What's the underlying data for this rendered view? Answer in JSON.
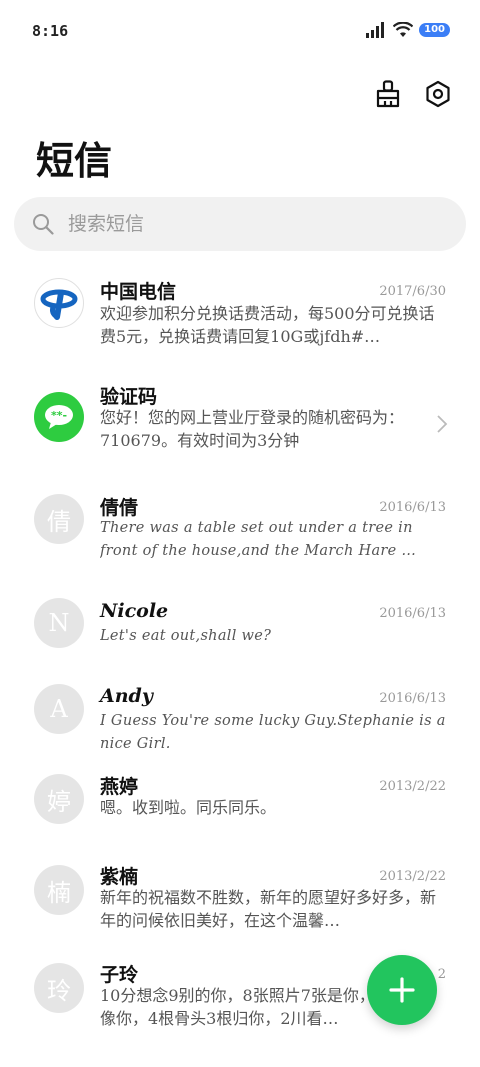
{
  "status_bar": {
    "time": "8:16",
    "battery": "100"
  },
  "page": {
    "title": "短信"
  },
  "search": {
    "placeholder": "搜索短信"
  },
  "messages": [
    {
      "name": "中国电信",
      "date": "2017/6/30",
      "preview": "欢迎参加积分兑换话费活动，每500分可兑换话费5元，兑换话费请回复10G或jfdh#…",
      "avatar": "telecom-logo"
    },
    {
      "name": "验证码",
      "date": "",
      "preview": "您好！您的网上营业厅登录的随机密码为：710679。有效时间为3分钟",
      "avatar": "message-bubble-icon"
    },
    {
      "name": "倩倩",
      "date": "2016/6/13",
      "preview": "There was a table set out under a tree in front of the house,and the March Hare …",
      "avatar_letter": "倩"
    },
    {
      "name": "Nicole",
      "date": "2016/6/13",
      "preview": "Let's eat out,shall we?",
      "avatar_letter": "N"
    },
    {
      "name": "Andy",
      "date": "2016/6/13",
      "preview": "I Guess You're some lucky Guy.Stephanie is a nice Girl.",
      "avatar_letter": "A"
    },
    {
      "name": "燕婷",
      "date": "2013/2/22",
      "preview": "嗯。收到啦。同乐同乐。",
      "avatar_letter": "婷"
    },
    {
      "name": "紫楠",
      "date": "2013/2/22",
      "preview": "新年的祝福数不胜数，新年的愿望好多好多，新年的问候依旧美好，在这个温馨…",
      "avatar_letter": "楠"
    },
    {
      "name": "子玲",
      "date": "2",
      "preview": "10分想念9别的你，8张照片7张是你，小狗5只像你，4根骨头3根归你，2川看…",
      "avatar_letter": "玲"
    }
  ],
  "colors": {
    "accent": "#22c55e",
    "avatar_bg": "#e5e5e5",
    "telecom_blue": "#1565c0"
  }
}
